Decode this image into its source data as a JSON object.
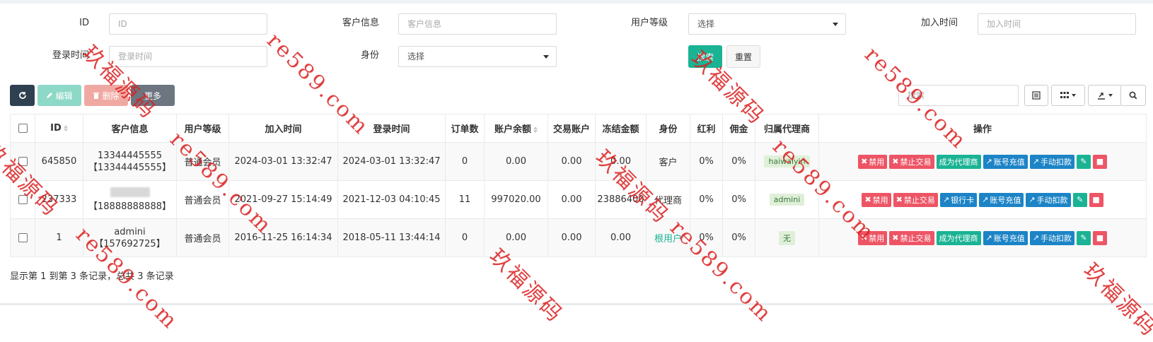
{
  "filters": {
    "id": {
      "label": "ID",
      "placeholder": "ID"
    },
    "customer": {
      "label": "客户信息",
      "placeholder": "客户信息"
    },
    "level": {
      "label": "用户等级",
      "value": "选择"
    },
    "join_time": {
      "label": "加入时间",
      "placeholder": "加入时间"
    },
    "login_time": {
      "label": "登录时间",
      "placeholder": "登录时间"
    },
    "identity": {
      "label": "身份",
      "value": "选择"
    },
    "search_button": "搜索",
    "reset_button": "重置"
  },
  "toolbar": {
    "edit": "编辑",
    "delete": "删除",
    "more": "更多",
    "search_placeholder": "搜索"
  },
  "table": {
    "headers": [
      "ID",
      "客户信息",
      "用户等级",
      "加入时间",
      "登录时间",
      "订单数",
      "账户余额",
      "交易账户",
      "冻结金额",
      "身份",
      "红利",
      "佣金",
      "归属代理商",
      "操作"
    ],
    "rows": [
      {
        "id": "645850",
        "customer_line1": "13344445555",
        "customer_line2": "【13344445555】",
        "level": "普通会员",
        "join_time": "2024-03-01 13:32:47",
        "login_time": "2024-03-01 13:32:47",
        "orders": "0",
        "balance": "0.00",
        "trade_account": "0.00",
        "frozen": "0.00",
        "identity": "客户",
        "bonus": "0%",
        "commission": "0%",
        "agent": "haiwaiyin"
      },
      {
        "id": "237333",
        "customer_line1": "",
        "customer_line2": "【18888888888】",
        "level": "普通会员",
        "join_time": "2021-09-27 15:14:49",
        "login_time": "2021-12-03 04:10:45",
        "orders": "11",
        "balance": "997020.00",
        "trade_account": "0.00",
        "frozen": "23886400",
        "identity": "代理商",
        "bonus": "0%",
        "commission": "0%",
        "agent": "admini"
      },
      {
        "id": "1",
        "customer_line1": "admini",
        "customer_line2": "【157692725】",
        "level": "普通会员",
        "join_time": "2016-11-25 16:14:34",
        "login_time": "2018-05-11 13:44:14",
        "orders": "0",
        "balance": "0.00",
        "trade_account": "0.00",
        "frozen": "0.00",
        "identity": "根用户",
        "bonus": "0%",
        "commission": "0%",
        "agent": "无"
      }
    ],
    "actions": {
      "disable": "禁用",
      "disable_trade": "禁止交易",
      "make_agent": "成为代理商",
      "bank_card": "银行卡",
      "recharge": "账号充值",
      "deduct": "手动扣款"
    }
  },
  "footer": {
    "summary": "显示第 1 到第 3 条记录，总共 3 条记录"
  },
  "watermark": {
    "text_cn": "玖福源码",
    "text_url": "re589.com"
  },
  "colors": {
    "primary": "#1ab394",
    "danger": "#ed5565",
    "info": "#1c84c6",
    "dark": "#2f4050"
  }
}
